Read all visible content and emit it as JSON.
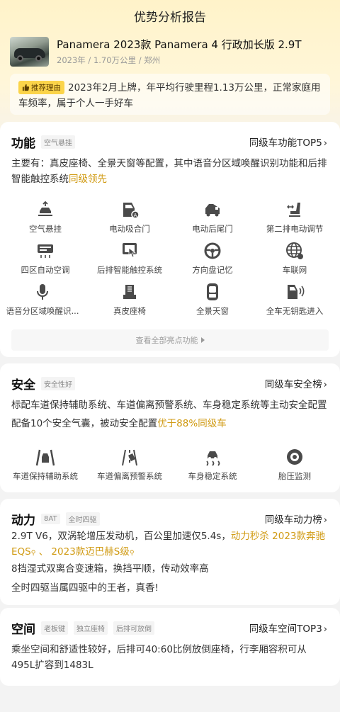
{
  "page": {
    "title": "优势分析报告"
  },
  "car": {
    "name": "Panamera 2023款 Panamera 4 行政加长版 2.9T",
    "meta": "2023年 / 1.70万公里 / 郑州"
  },
  "reason": {
    "badge": "推荐理由",
    "text": "2023年2月上牌，年平均行驶里程1.13万公里，正常家庭用车频率，属于个人一手好车"
  },
  "function": {
    "title": "功能",
    "tag": "空气悬挂",
    "link": "同级车功能TOP5",
    "desc": "主要有：真皮座椅、全景天窗等配置，其中语音分区域唤醒识别功能和后排智能触控系统",
    "desc_highlight": "同级领先",
    "items": [
      {
        "label": "空气悬挂",
        "icon": "air-suspension-icon"
      },
      {
        "label": "电动吸合门",
        "icon": "soft-close-door-icon"
      },
      {
        "label": "电动后尾门",
        "icon": "power-tailgate-icon"
      },
      {
        "label": "第二排电动调节",
        "icon": "second-row-seat-icon"
      },
      {
        "label": "四区自动空调",
        "icon": "climate-control-icon"
      },
      {
        "label": "后排智能触控系统",
        "icon": "rear-touch-control-icon"
      },
      {
        "label": "方向盘记忆",
        "icon": "steering-memory-icon"
      },
      {
        "label": "车联网",
        "icon": "connected-car-icon"
      },
      {
        "label": "语音分区域唤醒识...",
        "icon": "voice-recognition-icon"
      },
      {
        "label": "真皮座椅",
        "icon": "leather-seat-icon"
      },
      {
        "label": "全景天窗",
        "icon": "panoramic-roof-icon"
      },
      {
        "label": "全车无钥匙进入",
        "icon": "keyless-entry-icon"
      }
    ],
    "view_all": "查看全部亮点功能"
  },
  "safety": {
    "title": "安全",
    "tag": "安全性好",
    "link": "同级车安全榜",
    "desc1": "标配车道保持辅助系统、车道偏离预警系统、车身稳定系统等主动安全配置",
    "desc2": "配备10个安全气囊，被动安全配置",
    "desc2_highlight": "优于88%同级车",
    "items": [
      {
        "label": "车道保持辅助系统",
        "icon": "lane-keep-icon"
      },
      {
        "label": "车道偏离预警系统",
        "icon": "lane-departure-icon"
      },
      {
        "label": "车身稳定系统",
        "icon": "stability-control-icon"
      },
      {
        "label": "胎压监测",
        "icon": "tire-pressure-icon"
      }
    ]
  },
  "power": {
    "title": "动力",
    "tags": [
      "8AT",
      "全时四驱"
    ],
    "link": "同级车动力榜",
    "line1": "2.9T V6，双涡轮增压发动机，百公里加速仅5.4s，",
    "line1_highlight": "动力秒杀",
    "compare1": "2023款奔驰EQS",
    "sep": "、",
    "compare2": "2023款迈巴赫S级",
    "line2": "8挡湿式双离合变速箱，换挡平顺，传动效率高",
    "line3": "全时四驱当属四驱中的王者，真香!"
  },
  "space": {
    "title": "空间",
    "tags": [
      "老板键",
      "独立座椅",
      "后排可放倒"
    ],
    "link": "同级车空间TOP3",
    "desc": "乘坐空间和舒适性较好，后排可40:60比例放倒座椅，行李厢容积可从495L扩容到1483L"
  },
  "colors": {
    "accent": "#d09a12",
    "badge": "#fbd44a"
  }
}
